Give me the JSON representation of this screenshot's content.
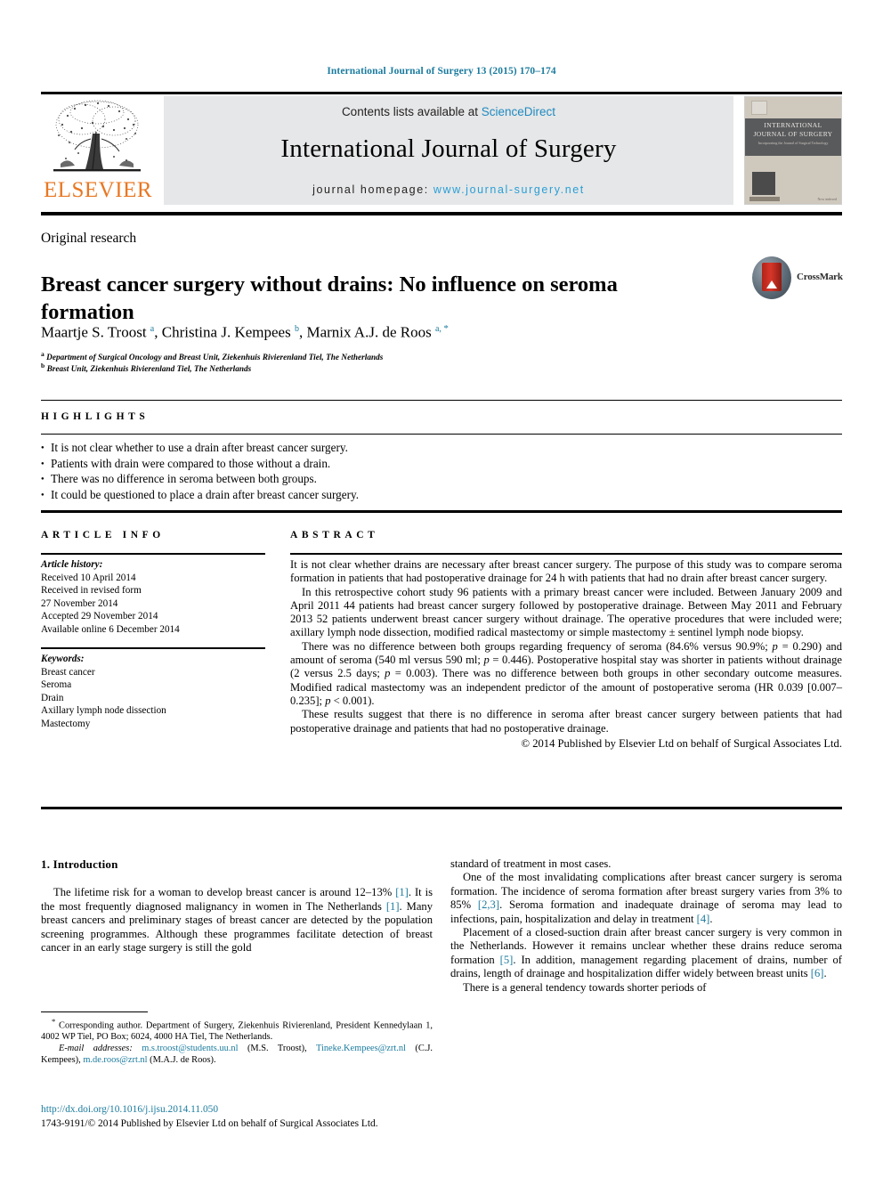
{
  "running_head": "International Journal of Surgery 13 (2015) 170–174",
  "masthead": {
    "publisher_logo_text": "ELSEVIER",
    "contents_prefix": "Contents lists available at ",
    "contents_link": "ScienceDirect",
    "journal_name": "International Journal of Surgery",
    "homepage_prefix": "journal homepage: ",
    "homepage_url": "www.journal-surgery.net",
    "cover": {
      "line1": "INTERNATIONAL",
      "line2": "JOURNAL OF SURGERY",
      "line3": "Incorporating the Journal of Surgical Technology",
      "footer": "Now indexed"
    }
  },
  "article": {
    "type": "Original research",
    "title": "Breast cancer surgery without drains: No influence on seroma formation",
    "crossmark_label": "CrossMark",
    "authors_html": "Maartje S. Troost <sup class=\"sup\">a</sup>, Christina J. Kempees <sup class=\"sup\">b</sup>, Marnix A.J. de Roos <sup class=\"sup\">a, </sup><sup class=\"sup-star\">*</sup>",
    "affiliation_a": "Department of Surgical Oncology and Breast Unit, Ziekenhuis Rivierenland Tiel, The Netherlands",
    "affiliation_b": "Breast Unit, Ziekenhuis Rivierenland Tiel, The Netherlands"
  },
  "highlights": {
    "heading": "HIGHLIGHTS",
    "items": [
      "It is not clear whether to use a drain after breast cancer surgery.",
      "Patients with drain were compared to those without a drain.",
      "There was no difference in seroma between both groups.",
      "It could be questioned to place a drain after breast cancer surgery."
    ]
  },
  "article_info": {
    "heading": "ARTICLE INFO",
    "history_label": "Article history:",
    "history": [
      "Received 10 April 2014",
      "Received in revised form",
      "27 November 2014",
      "Accepted 29 November 2014",
      "Available online 6 December 2014"
    ],
    "keywords_label": "Keywords:",
    "keywords": [
      "Breast cancer",
      "Seroma",
      "Drain",
      "Axillary lymph node dissection",
      "Mastectomy"
    ]
  },
  "abstract": {
    "heading": "ABSTRACT",
    "p1": "It is not clear whether drains are necessary after breast cancer surgery. The purpose of this study was to compare seroma formation in patients that had postoperative drainage for 24 h with patients that had no drain after breast cancer surgery.",
    "p2": "In this retrospective cohort study 96 patients with a primary breast cancer were included. Between January 2009 and April 2011 44 patients had breast cancer surgery followed by postoperative drainage. Between May 2011 and February 2013 52 patients underwent breast cancer surgery without drainage. The operative procedures that were included were; axillary lymph node dissection, modified radical mastectomy or simple mastectomy ± sentinel lymph node biopsy.",
    "p3_html": "There was no difference between both groups regarding frequency of seroma (84.6% versus 90.9%; <i>p</i> = 0.290) and amount of seroma (540 ml versus 590 ml; <i>p</i> = 0.446). Postoperative hospital stay was shorter in patients without drainage (2 versus 2.5 days; <i>p</i> = 0.003). There was no difference between both groups in other secondary outcome measures. Modified radical mastectomy was an independent predictor of the amount of postoperative seroma (HR 0.039 [0.007–0.235]; <i>p</i> &lt; 0.001).",
    "p4": "These results suggest that there is no difference in seroma after breast cancer surgery between patients that had postoperative drainage and patients that had no postoperative drainage.",
    "copyright": "© 2014 Published by Elsevier Ltd on behalf of Surgical Associates Ltd."
  },
  "body": {
    "section_number_title": "1. Introduction",
    "left_p1_html": "The lifetime risk for a woman to develop breast cancer is around 12–13% <span class=\"ref\">[1]</span>. It is the most frequently diagnosed malignancy in women in The Netherlands <span class=\"ref\">[1]</span>. Many breast cancers and preliminary stages of breast cancer are detected by the population screening programmes. Although these programmes facilitate detection of breast cancer in an early stage surgery is still the gold",
    "right_p1": "standard of treatment in most cases.",
    "right_p2_html": "One of the most invalidating complications after breast cancer surgery is seroma formation. The incidence of seroma formation after breast surgery varies from 3% to 85% <span class=\"ref\">[2,3]</span>. Seroma formation and inadequate drainage of seroma may lead to infections, pain, hospitalization and delay in treatment <span class=\"ref\">[4]</span>.",
    "right_p3_html": "Placement of a closed-suction drain after breast cancer surgery is very common in the Netherlands. However it remains unclear whether these drains reduce seroma formation <span class=\"ref\">[5]</span>. In addition, management regarding placement of drains, number of drains, length of drainage and hospitalization differ widely between breast units <span class=\"ref\">[6]</span>.",
    "right_p4": "There is a general tendency towards shorter periods of"
  },
  "footnotes": {
    "corresponding_html": "<sup>*</sup> Corresponding author. Department of Surgery, Ziekenhuis Rivierenland, President Kennedylaan 1, 4002 WP Tiel, PO Box; 6024, 4000 HA Tiel, The Netherlands.",
    "email_html": "<span class=\"lbl\">E-mail addresses:</span> <span class=\"mail-link\">m.s.troost@students.uu.nl</span> (M.S. Troost), <span class=\"mail-link\">Tineke.Kempees@zrt.nl</span> (C.J. Kempees), <span class=\"mail-link\">m.de.roos@zrt.nl</span> (M.A.J. de Roos).",
    "doi": "http://dx.doi.org/10.1016/j.ijsu.2014.11.050",
    "issn_line": "1743-9191/© 2014 Published by Elsevier Ltd on behalf of Surgical Associates Ltd."
  },
  "colors": {
    "link_blue": "#1b7b9e",
    "sciencedirect_blue": "#1f8ac0",
    "homepage_blue": "#2a9fd6",
    "elsevier_orange": "#e87722",
    "masthead_grey": "#e6e7e8"
  }
}
